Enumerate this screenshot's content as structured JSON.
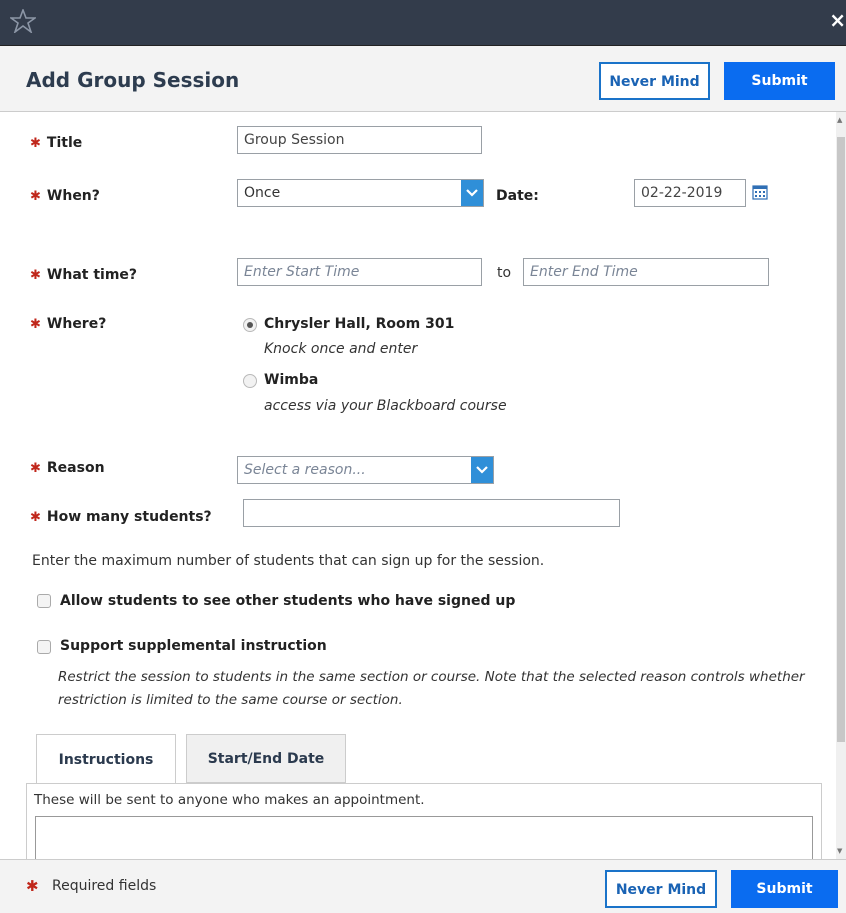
{
  "window": {
    "logo_icon": "star-logo-icon",
    "close_label": "×"
  },
  "header": {
    "title": "Add Group Session",
    "never_mind_label": "Never Mind",
    "submit_label": "Submit"
  },
  "form": {
    "title": {
      "label": "Title",
      "value": "Group Session"
    },
    "when": {
      "label": "When?",
      "value": "Once",
      "date_label": "Date:",
      "date_value": "02-22-2019"
    },
    "time": {
      "label": "What time?",
      "start_placeholder": "Enter Start Time",
      "to_label": "to",
      "end_placeholder": "Enter End Time"
    },
    "where": {
      "label": "Where?",
      "options": [
        {
          "name": "Chrysler Hall, Room 301",
          "desc": "Knock once and enter",
          "selected": true
        },
        {
          "name": "Wimba",
          "desc": "access via your Blackboard course",
          "selected": false
        }
      ]
    },
    "reason": {
      "label": "Reason",
      "placeholder": "Select a reason..."
    },
    "students": {
      "label": "How many students?",
      "value": ""
    },
    "max_help": "Enter the maximum number of students that can sign up for the session.",
    "allow_see": {
      "label": "Allow students to see other students who have signed up",
      "checked": false
    },
    "supplemental": {
      "label": "Support supplemental instruction",
      "checked": false,
      "desc_line1": "Restrict the session to students in the same section or course. Note that the selected reason controls whether",
      "desc_line2": "restriction is limited to the same course or section."
    },
    "tabs": [
      {
        "label": "Instructions",
        "active": true
      },
      {
        "label": "Start/End Date",
        "active": false
      }
    ],
    "instructions_help": "These will be sent to anyone who makes an appointment.",
    "instructions_value": ""
  },
  "footer": {
    "required_label": "Required fields",
    "never_mind_label": "Never Mind",
    "submit_label": "Submit"
  },
  "colors": {
    "topbar": "#333c4b",
    "primary": "#0a6cf0",
    "required_star": "#c0271b",
    "select_arrow": "#2f8fd8"
  }
}
